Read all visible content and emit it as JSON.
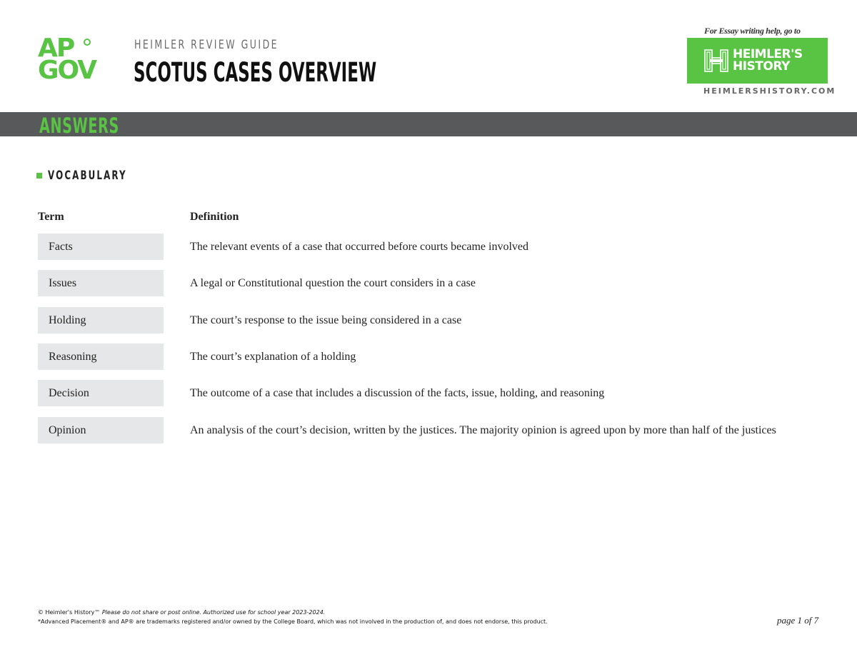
{
  "header": {
    "logo": {
      "line1": "AP",
      "line2": "GOV"
    },
    "guide_label": "HEIMLER REVIEW GUIDE",
    "title": "SCOTUS CASES OVERVIEW",
    "essay_help": "For Essay writing help, go to",
    "brand": {
      "line1": "HEIMLER'S",
      "line2": "HISTORY",
      "url": "HEIMLERSHISTORY.COM"
    }
  },
  "band": {
    "label": "ANSWERS"
  },
  "section": {
    "title": "VOCABULARY"
  },
  "vocab_table": {
    "headers": {
      "term": "Term",
      "definition": "Definition"
    },
    "rows": [
      {
        "term": "Facts",
        "definition": "The relevant events of a case that occurred before courts became involved"
      },
      {
        "term": "Issues",
        "definition": "A legal or Constitutional question the court considers in a case"
      },
      {
        "term": "Holding",
        "definition": "The court’s response to the issue being considered in a case"
      },
      {
        "term": "Reasoning",
        "definition": "The court’s explanation of a holding"
      },
      {
        "term": "Decision",
        "definition": "The outcome of a case that includes a discussion of the facts, issue, holding, and reasoning"
      },
      {
        "term": "Opinion",
        "definition": "An analysis of the court’s decision, written by the justices. The majority opinion is agreed upon by more than half of the justices"
      }
    ]
  },
  "footer": {
    "copyright": "© Heimler's History™",
    "notice": "Please do not share or post online. Authorized use for school year 2023-2024.",
    "trademark": "*Advanced Placement® and AP® are trademarks registered and/or owned by the College Board, which was not involved in the production of, and does not endorse, this product.",
    "page": "page 1 of 7"
  },
  "colors": {
    "brand_green": "#59c443",
    "band_gray": "#58595b",
    "term_bg": "#e6e7e8"
  }
}
